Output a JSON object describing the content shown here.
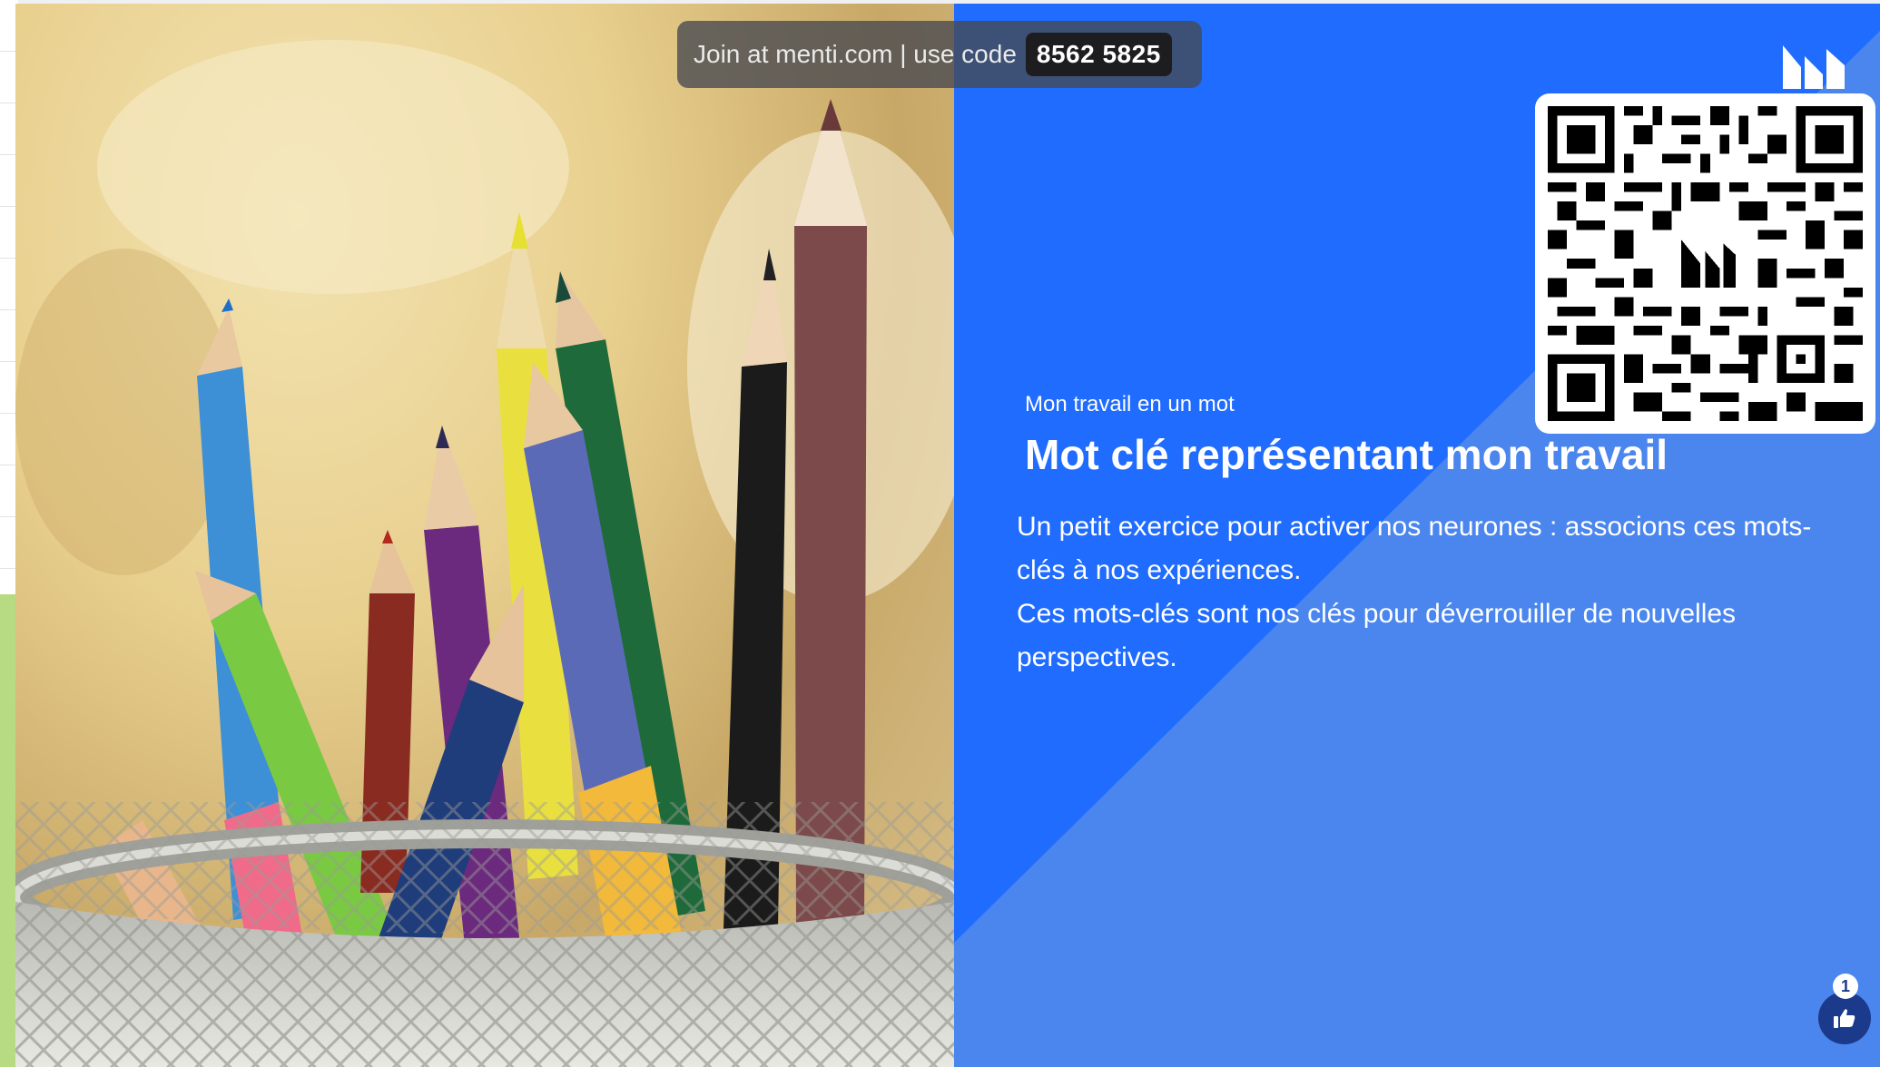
{
  "join_bar": {
    "prefix": "Join at menti.com | use code",
    "code": "8562 5825"
  },
  "slide": {
    "subtitle": "Mon travail en un mot",
    "title": "Mot clé représentant mon travail",
    "description": [
      "Un petit exercice pour activer nos neurones : associons ces mots-clés à nos expériences.",
      "Ces mots-clés sont nos clés pour déverrouiller de nouvelles perspectives."
    ]
  },
  "reactions": {
    "count": "1",
    "icon": "thumbs-up-icon"
  },
  "colors": {
    "accent": "#1f6cff",
    "accent_light": "#4a86ee",
    "reaction_bg": "#1b3a8c"
  }
}
